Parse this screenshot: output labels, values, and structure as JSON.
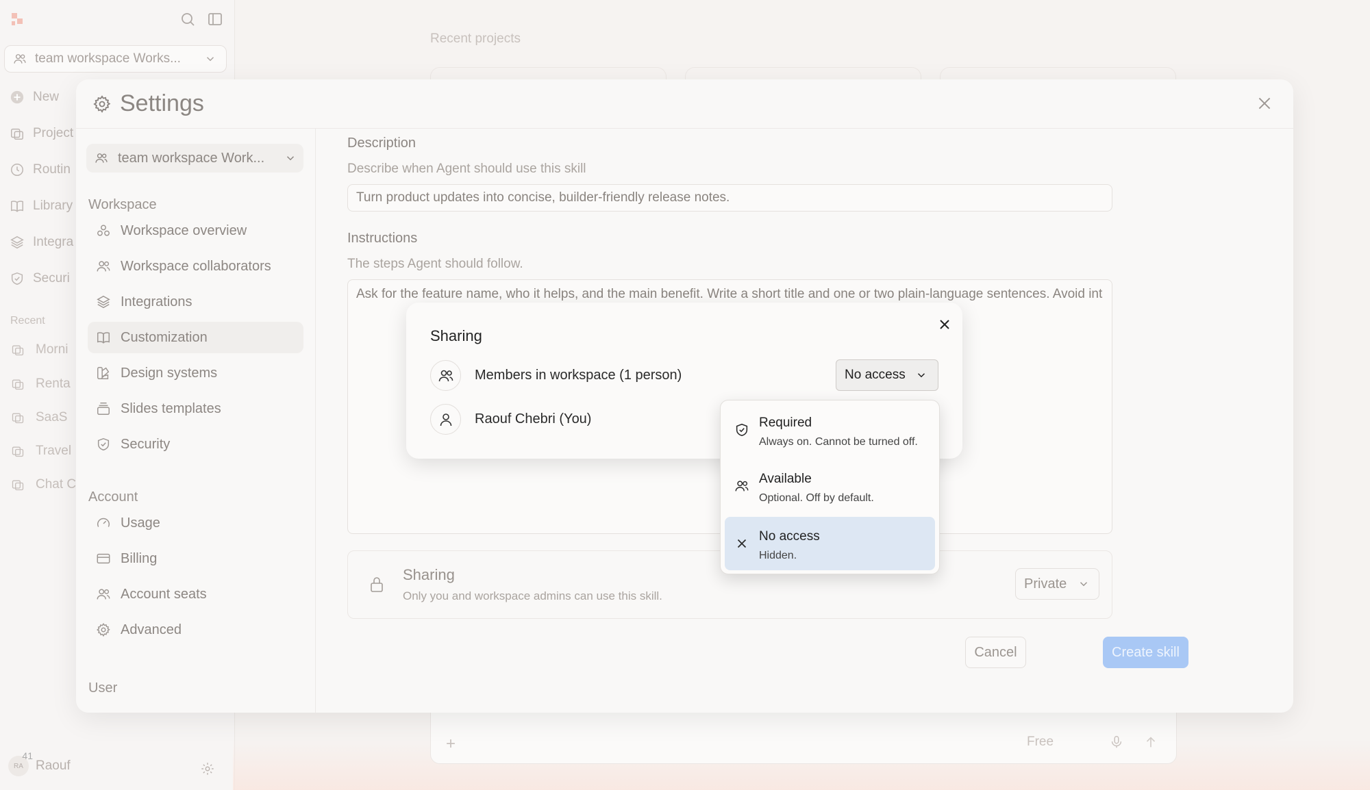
{
  "app": {
    "workspace_switcher": "team workspace Works...",
    "nav": [
      {
        "label": "New",
        "icon": "plus-circle-icon"
      },
      {
        "label": "Project",
        "icon": "projects-icon"
      },
      {
        "label": "Routin",
        "icon": "clock-icon"
      },
      {
        "label": "Library",
        "icon": "book-icon"
      },
      {
        "label": "Integra",
        "icon": "layers-icon"
      },
      {
        "label": "Securi",
        "icon": "shield-icon"
      }
    ],
    "recent_label": "Recent",
    "recent": [
      "Morni",
      "Renta",
      "SaaS",
      "Travel",
      "Chat C"
    ],
    "user_name": "Raouf",
    "user_initials": "RA",
    "user_badge": "41",
    "main_title": "Recent projects",
    "composer_model": "Free"
  },
  "settings": {
    "title": "Settings",
    "workspace": "team workspace Work...",
    "sections": [
      {
        "label": "Workspace",
        "items": [
          {
            "label": "Workspace overview",
            "icon": "overview-icon"
          },
          {
            "label": "Workspace collaborators",
            "icon": "users-icon"
          },
          {
            "label": "Integrations",
            "icon": "layers-icon"
          },
          {
            "label": "Customization",
            "icon": "book-icon",
            "active": true
          },
          {
            "label": "Design systems",
            "icon": "palette-icon"
          },
          {
            "label": "Slides templates",
            "icon": "slides-icon"
          },
          {
            "label": "Security",
            "icon": "shield-icon"
          }
        ]
      },
      {
        "label": "Account",
        "items": [
          {
            "label": "Usage",
            "icon": "gauge-icon"
          },
          {
            "label": "Billing",
            "icon": "card-icon"
          },
          {
            "label": "Account seats",
            "icon": "users-icon"
          },
          {
            "label": "Advanced",
            "icon": "gear-icon"
          }
        ]
      },
      {
        "label": "User",
        "items": []
      }
    ],
    "form": {
      "description_label": "Description",
      "description_hint": "Describe when Agent should use this skill",
      "description_value": "Turn product updates into concise, builder-friendly release notes.",
      "instructions_label": "Instructions",
      "instructions_hint": "The steps Agent should follow.",
      "instructions_value": "Ask for the feature name, who it helps, and the main benefit. Write a short title and one or two plain-language sentences. Avoid int",
      "sharing_title": "Sharing",
      "sharing_desc": "Only you and workspace admins can use this skill.",
      "sharing_value": "Private",
      "cancel": "Cancel",
      "create": "Create skill"
    }
  },
  "sharing_dialog": {
    "title": "Sharing",
    "rows": [
      {
        "label": "Members in workspace (1 person)",
        "icon": "users-icon"
      },
      {
        "label": "Raouf Chebri (You)",
        "icon": "user-icon"
      }
    ],
    "access_value": "No access",
    "options": [
      {
        "title": "Required",
        "desc": "Always on. Cannot be turned off.",
        "icon": "shield-check-icon"
      },
      {
        "title": "Available",
        "desc": "Optional. Off by default.",
        "icon": "users-icon"
      },
      {
        "title": "No access",
        "desc": "Hidden.",
        "icon": "x-icon",
        "selected": true
      }
    ]
  },
  "colors": {
    "accent_button": "#a9c8f5",
    "selected_option": "#dde7f3"
  }
}
